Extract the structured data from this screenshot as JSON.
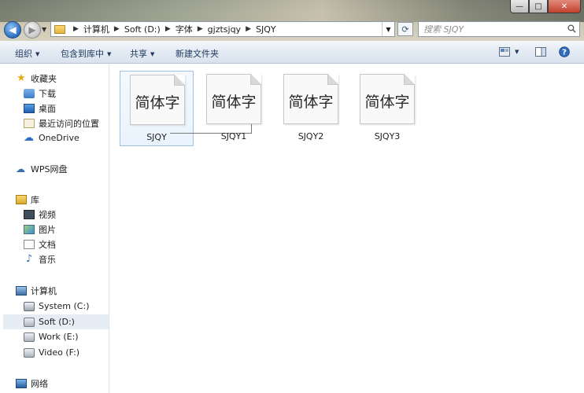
{
  "window": {
    "min": "—",
    "max": "□",
    "close": "✕"
  },
  "address": {
    "crumbs": [
      "计算机",
      "Soft (D:)",
      "字体",
      "gjztsjqy",
      "SJQY"
    ]
  },
  "search": {
    "placeholder": "搜索 SJQY"
  },
  "toolbar": {
    "organize": "组织",
    "include_library": "包含到库中",
    "share": "共享",
    "new_folder": "新建文件夹"
  },
  "sidebar": {
    "favorites": "收藏夹",
    "downloads": "下载",
    "desktop": "桌面",
    "recent": "最近访问的位置",
    "onedrive": "OneDrive",
    "wps": "WPS网盘",
    "libraries": "库",
    "videos": "视频",
    "pictures": "图片",
    "documents": "文档",
    "music": "音乐",
    "computer": "计算机",
    "drive_c": "System (C:)",
    "drive_d": "Soft (D:)",
    "drive_e": "Work (E:)",
    "drive_f": "Video (F:)",
    "network": "网络"
  },
  "files": [
    {
      "name": "SJQY",
      "preview": "简体字"
    },
    {
      "name": "SJQY1",
      "preview": "简体字"
    },
    {
      "name": "SJQY2",
      "preview": "简体字"
    },
    {
      "name": "SJQY3",
      "preview": "简体字"
    }
  ]
}
